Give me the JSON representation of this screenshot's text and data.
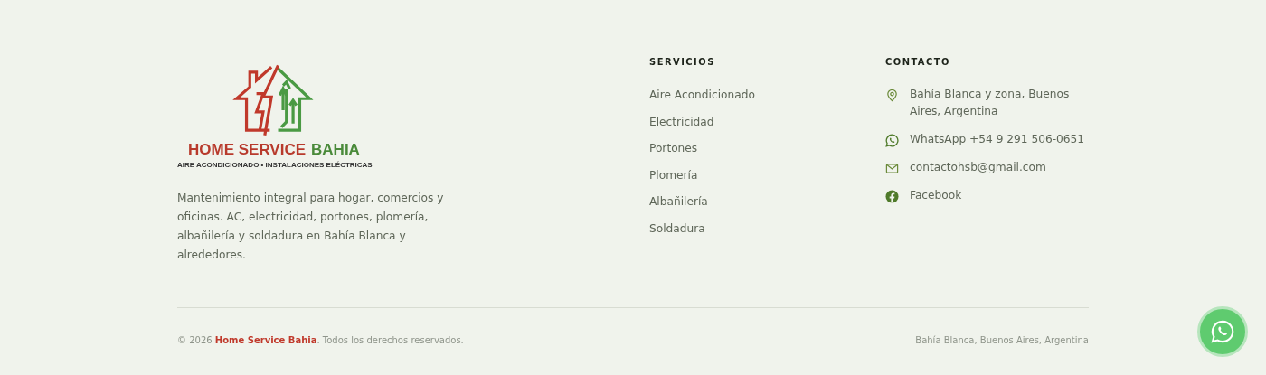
{
  "brand": {
    "name_main": "HOME SERVICE",
    "name_accent": "BAHIA",
    "tagline": "AIRE ACONDICIONADO • INSTALACIONES ELÉCTRICAS",
    "description": "Mantenimiento integral para hogar, comercios y oficinas. AC, electricidad, portones, plomería, albañilería y soldadura en Bahía Blanca y alrededores."
  },
  "services": {
    "heading": "SERVICIOS",
    "items": [
      "Aire Acondicionado",
      "Electricidad",
      "Portones",
      "Plomería",
      "Albañilería",
      "Soldadura"
    ]
  },
  "contact": {
    "heading": "CONTACTO",
    "items": [
      {
        "kind": "location",
        "text": "Bahía Blanca y zona, Buenos Aires, Argentina"
      },
      {
        "kind": "whatsapp",
        "text": "WhatsApp +54 9 291 506-0651"
      },
      {
        "kind": "email",
        "text": "contactohsb@gmail.com"
      },
      {
        "kind": "facebook",
        "text": "Facebook"
      }
    ]
  },
  "bottom": {
    "copyright": "© 2026 **Home Service Bahia**. Todos los derechos reservados.",
    "location": "Bahía Blanca, Buenos Aires, Argentina"
  }
}
